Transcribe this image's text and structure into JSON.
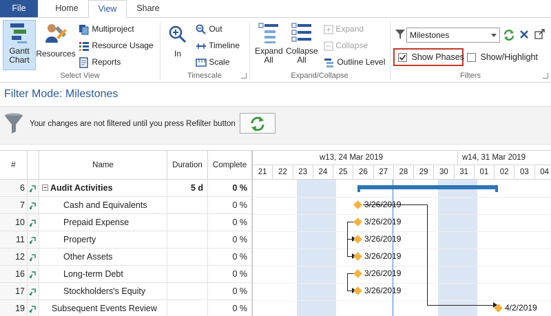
{
  "tabs": {
    "file": "File",
    "home": "Home",
    "view": "View",
    "share": "Share"
  },
  "ribbon": {
    "select_view": {
      "label": "Select View",
      "gantt_chart": "Gantt Chart",
      "resources": "Resources",
      "multiproject": "Multiproject",
      "resource_usage": "Resource Usage",
      "reports": "Reports"
    },
    "timescale": {
      "label": "Timescale",
      "zoom_in": "In",
      "zoom_out": "Out",
      "timeline": "Timeline",
      "scale": "Scale"
    },
    "expand_collapse": {
      "label": "Expand/Collapse",
      "expand_all": "Expand All",
      "collapse_all": "Collapse All",
      "expand": "Expand",
      "collapse": "Collapse",
      "outline_level": "Outline Level"
    },
    "filters": {
      "label": "Filters",
      "selected_filter": "Milestones",
      "show_phases": "Show Phases",
      "show_phases_checked": true,
      "show_highlight": "Show/Highlight",
      "show_highlight_checked": false
    }
  },
  "filter_mode": "Filter Mode: Milestones",
  "notice": {
    "text": "Your changes are not filtered until you press Refilter button"
  },
  "grid": {
    "columns": [
      "#",
      "Name",
      "Duration",
      "Complete"
    ],
    "rows": [
      {
        "id": "6",
        "name": "Audit Activities",
        "duration": "5 d",
        "complete": "0 %",
        "summary": true
      },
      {
        "id": "7",
        "name": "Cash and Equivalents",
        "duration": "",
        "complete": "0 %",
        "summary": false
      },
      {
        "id": "10",
        "name": "Prepaid Expense",
        "duration": "",
        "complete": "0 %",
        "summary": false
      },
      {
        "id": "11",
        "name": "Property",
        "duration": "",
        "complete": "0 %",
        "summary": false
      },
      {
        "id": "12",
        "name": "Other Assets",
        "duration": "",
        "complete": "0 %",
        "summary": false
      },
      {
        "id": "16",
        "name": "Long-term Debt",
        "duration": "",
        "complete": "0 %",
        "summary": false
      },
      {
        "id": "17",
        "name": "Stockholders's Equity",
        "duration": "",
        "complete": "0 %",
        "summary": false
      },
      {
        "id": "19",
        "name": "Subsequent Events Review",
        "duration": "",
        "complete": "0 %",
        "summary": false
      }
    ]
  },
  "timeline": {
    "weeks": [
      "w13, 24 Mar 2019",
      "w14, 31 Mar 2019"
    ],
    "days": [
      "21",
      "22",
      "23",
      "24",
      "25",
      "26",
      "27",
      "28",
      "29",
      "30",
      "31",
      "01",
      "02",
      "03",
      "04"
    ],
    "milestones": [
      "3/26/2019",
      "3/26/2019",
      "3/26/2019",
      "3/26/2019",
      "3/26/2019",
      "3/26/2019",
      "4/2/2019"
    ]
  },
  "colors": {
    "accent": "#2b579a",
    "summary_bar": "#2e75b6",
    "milestone": "#f5b13d",
    "weekend": "#dbe6f4",
    "highlight_border": "#c0392b"
  }
}
